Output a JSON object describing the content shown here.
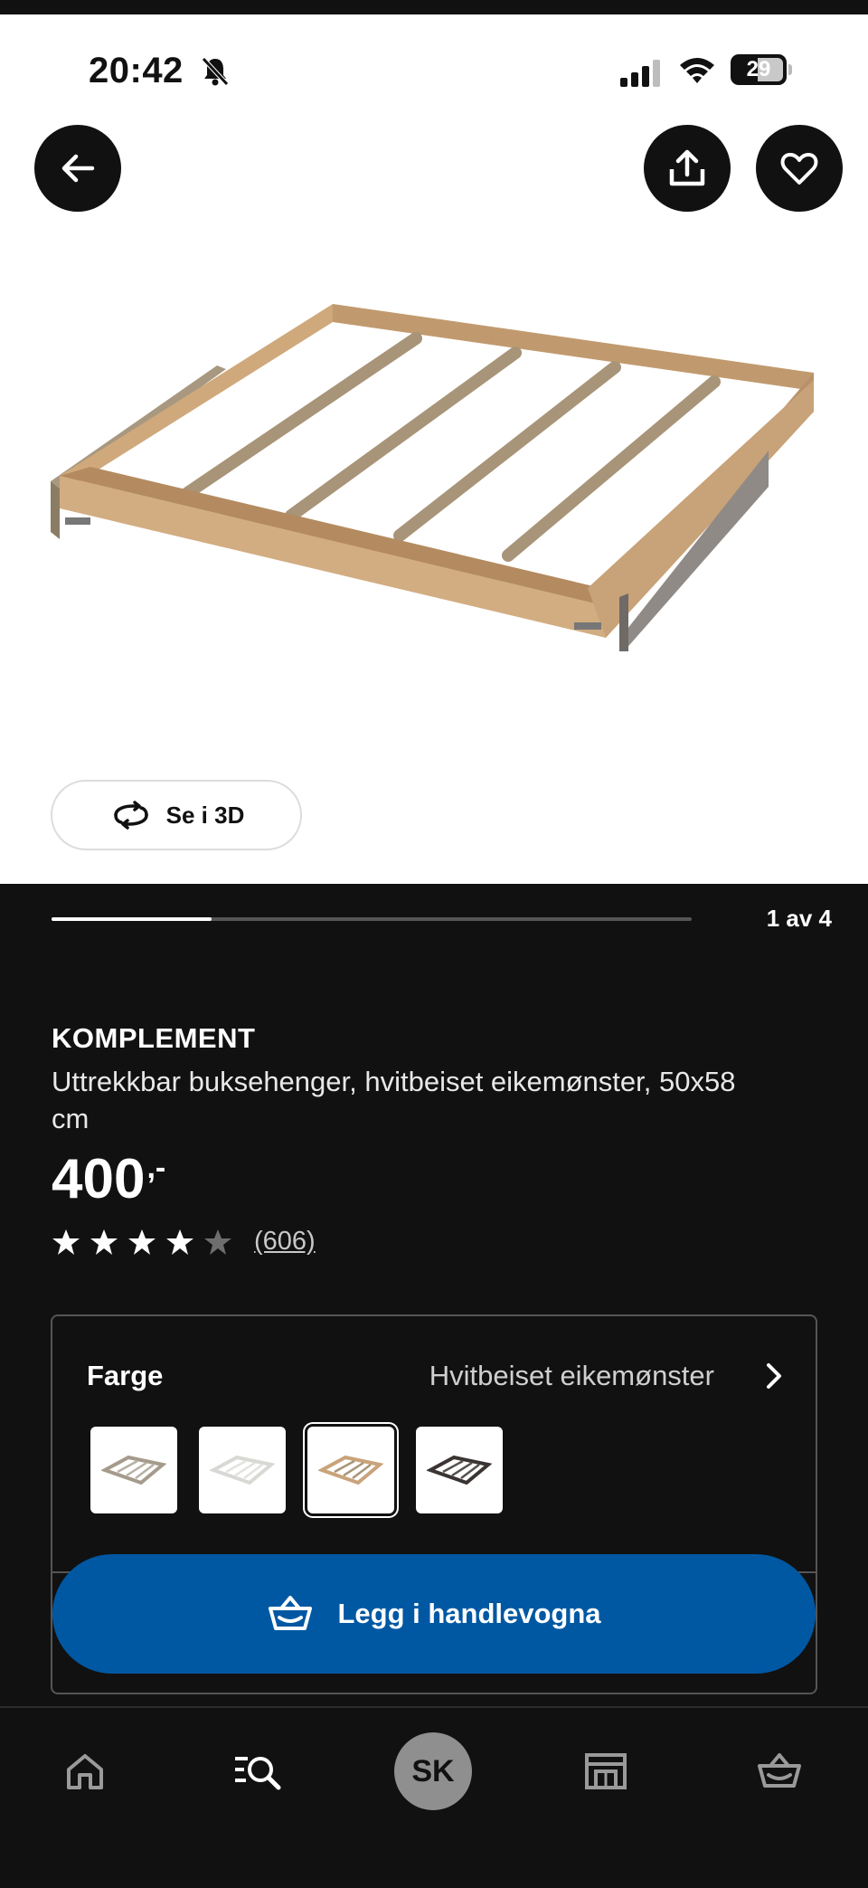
{
  "status_bar": {
    "time": "20:42",
    "battery": "29"
  },
  "gallery": {
    "view3d_label": "Se i 3D",
    "counter": "1 av 4",
    "progress_fraction": 0.25
  },
  "product": {
    "name": "KOMPLEMENT",
    "description": "Uttrekkbar buksehenger, hvitbeiset eikemønster, 50x58 cm",
    "price": "400",
    "price_suffix": ",-",
    "rating_stars": 4,
    "review_count": "(606)"
  },
  "color_picker": {
    "label": "Farge",
    "value": "Hvitbeiset eikemønster",
    "swatches": [
      {
        "name": "grey-beige",
        "selected": false
      },
      {
        "name": "white",
        "selected": false
      },
      {
        "name": "white-stained-oak",
        "selected": true
      },
      {
        "name": "black-brown",
        "selected": false
      }
    ]
  },
  "cart_button": {
    "label": "Legg i handlevogna"
  },
  "bottom_nav": {
    "items": [
      "home-icon",
      "search-list-icon",
      "profile-avatar",
      "store-icon",
      "cart-icon"
    ],
    "avatar_initials": "SK"
  },
  "colors": {
    "accent": "#0058a3",
    "background": "#111111",
    "wood": "#c9a37a"
  }
}
